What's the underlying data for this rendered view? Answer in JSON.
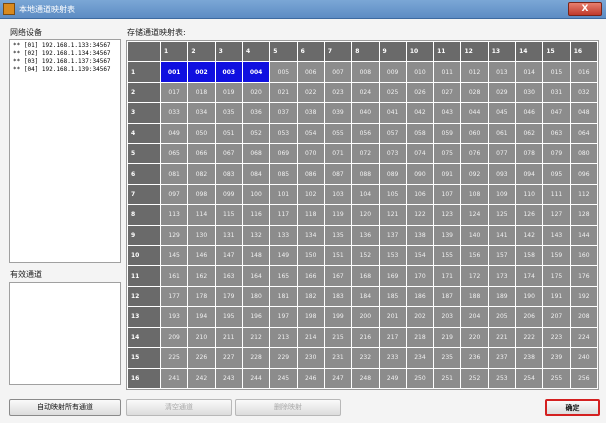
{
  "window": {
    "title": "本地通道映射表",
    "close_label": "X"
  },
  "labels": {
    "online_devices": "网络设备",
    "valid_channels": "有效通道",
    "grid_title": "存储通道映射表:"
  },
  "devices": [
    {
      "prefix": "**",
      "index": "[01]",
      "address": "192.168.1.133:34567"
    },
    {
      "prefix": "**",
      "index": "[02]",
      "address": "192.168.1.134:34567"
    },
    {
      "prefix": "**",
      "index": "[03]",
      "address": "192.168.1.137:34567"
    },
    {
      "prefix": "**",
      "index": "[04]",
      "address": "192.168.1.139:34567"
    }
  ],
  "grid": {
    "columns": [
      "1",
      "2",
      "3",
      "4",
      "5",
      "6",
      "7",
      "8",
      "9",
      "10",
      "11",
      "12",
      "13",
      "14",
      "15",
      "16"
    ],
    "rows": [
      "1",
      "2",
      "3",
      "4",
      "5",
      "6",
      "7",
      "8",
      "9",
      "10",
      "11",
      "12",
      "13",
      "14",
      "15",
      "16"
    ],
    "selected_cells": [
      "001",
      "002",
      "003",
      "004"
    ]
  },
  "buttons": {
    "auto_map": "自动映射所有通道",
    "delete_channel": "清空通道",
    "cancel_mapping": "删除映射",
    "ok": "确定"
  },
  "colors": {
    "selected": "#1010e0",
    "cell": "#8c8c8c",
    "header": "#6a6a6a",
    "ok_border": "#d42020"
  }
}
